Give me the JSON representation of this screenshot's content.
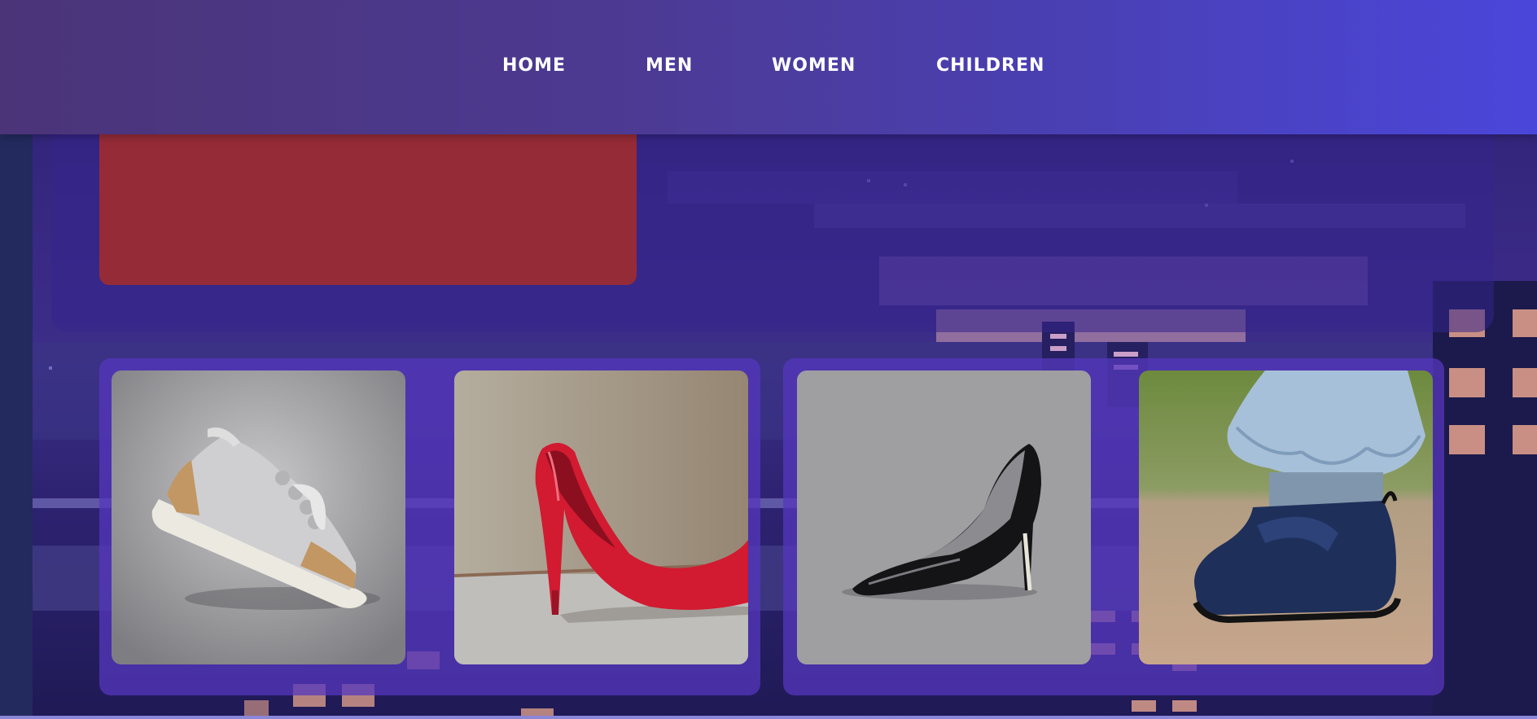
{
  "nav": {
    "items": [
      {
        "label": "HOME"
      },
      {
        "label": "MEN"
      },
      {
        "label": "WOMEN"
      },
      {
        "label": "CHILDREN"
      }
    ]
  },
  "colors": {
    "header_start": "#4b3478",
    "header_end": "#4b46db",
    "hero_banner": "#952b37",
    "card_shell": "#5537be"
  },
  "products": [
    {
      "image": "white-tan-sneaker-image"
    },
    {
      "image": "red-stiletto-heel-image"
    },
    {
      "image": "black-patent-pump-image"
    },
    {
      "image": "navy-child-boot-image"
    }
  ]
}
